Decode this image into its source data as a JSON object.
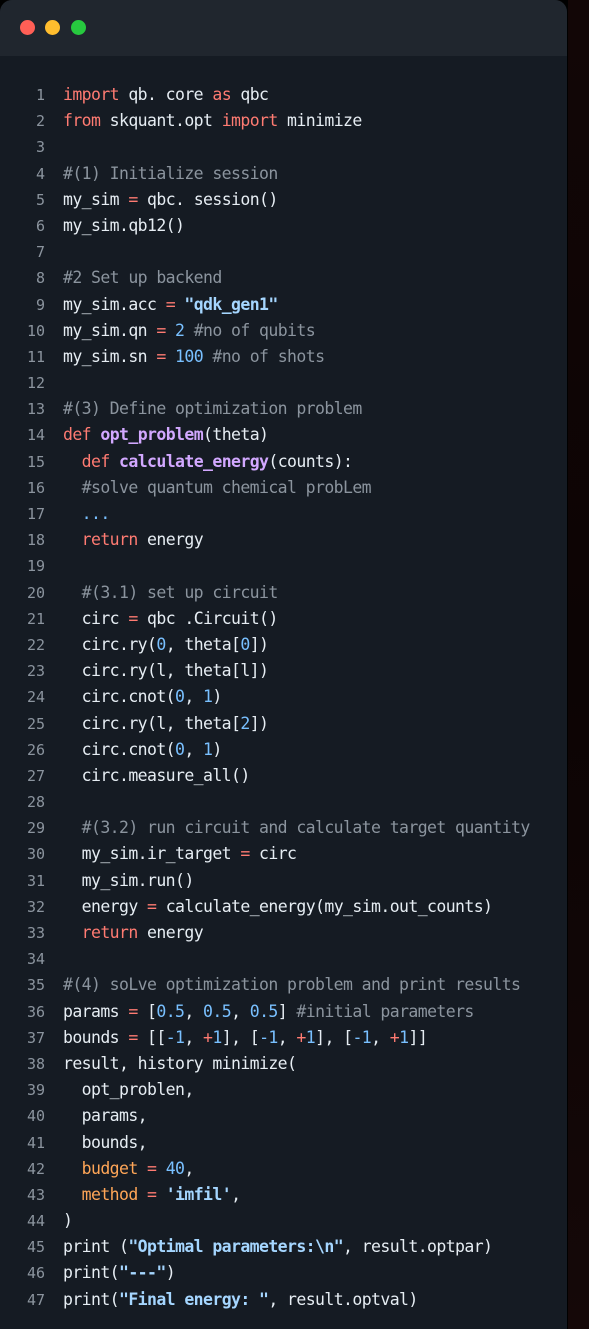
{
  "window": {
    "controls": [
      "close",
      "minimize",
      "maximize"
    ],
    "colors": {
      "background": "#151b23",
      "titlebar": "#20262e",
      "close": "#ff5f56",
      "minimize": "#ffbd2e",
      "maximize": "#27c93f"
    }
  },
  "syntax_colors": {
    "keyword": "#ff7b72",
    "function": "#d2a8ff",
    "string": "#a5d6ff",
    "number": "#79c0ff",
    "comment": "#8b949e",
    "plain": "#e6edf3",
    "argument": "#ffa657"
  },
  "lines": [
    {
      "n": "1",
      "tokens": [
        [
          "kw",
          "import"
        ],
        [
          "pl",
          " qb. core "
        ],
        [
          "kw",
          "as"
        ],
        [
          "pl",
          " qbc"
        ]
      ]
    },
    {
      "n": "2",
      "tokens": [
        [
          "kw",
          "from"
        ],
        [
          "pl",
          " skquant.opt "
        ],
        [
          "kw",
          "import"
        ],
        [
          "pl",
          " minimize"
        ]
      ]
    },
    {
      "n": "3",
      "tokens": []
    },
    {
      "n": "4",
      "tokens": [
        [
          "cm",
          "#(1) Initialize session"
        ]
      ]
    },
    {
      "n": "5",
      "tokens": [
        [
          "pl",
          "my_sim "
        ],
        [
          "op",
          "="
        ],
        [
          "pl",
          " qbc. session()"
        ]
      ]
    },
    {
      "n": "6",
      "tokens": [
        [
          "pl",
          "my_sim.qb12()"
        ]
      ]
    },
    {
      "n": "7",
      "tokens": []
    },
    {
      "n": "8",
      "tokens": [
        [
          "cm",
          "#2 Set up backend"
        ]
      ]
    },
    {
      "n": "9",
      "tokens": [
        [
          "pl",
          "my_sim.acc "
        ],
        [
          "op",
          "="
        ],
        [
          "pl",
          " "
        ],
        [
          "str",
          "\"qdk_gen1\""
        ]
      ]
    },
    {
      "n": "10",
      "tokens": [
        [
          "pl",
          "my_sim.qn "
        ],
        [
          "op",
          "="
        ],
        [
          "pl",
          " "
        ],
        [
          "num",
          "2"
        ],
        [
          "pl",
          " "
        ],
        [
          "cm",
          "#no of qubits"
        ]
      ]
    },
    {
      "n": "11",
      "tokens": [
        [
          "pl",
          "my_sim.sn "
        ],
        [
          "op",
          "="
        ],
        [
          "pl",
          " "
        ],
        [
          "num",
          "100"
        ],
        [
          "pl",
          " "
        ],
        [
          "cm",
          "#no of shots"
        ]
      ]
    },
    {
      "n": "12",
      "tokens": []
    },
    {
      "n": "13",
      "tokens": [
        [
          "cm",
          "#(3) Define optimization problem"
        ]
      ]
    },
    {
      "n": "14",
      "tokens": [
        [
          "kw",
          "def"
        ],
        [
          "pl",
          " "
        ],
        [
          "fn",
          "opt_problem"
        ],
        [
          "pl",
          "(theta)"
        ]
      ]
    },
    {
      "n": "15",
      "tokens": [
        [
          "pl",
          "  "
        ],
        [
          "kw",
          "def"
        ],
        [
          "pl",
          " "
        ],
        [
          "fn",
          "calculate_energy"
        ],
        [
          "pl",
          "(counts):"
        ]
      ]
    },
    {
      "n": "16",
      "tokens": [
        [
          "pl",
          "  "
        ],
        [
          "cm",
          "#solve quantum chemical probLem"
        ]
      ]
    },
    {
      "n": "17",
      "tokens": [
        [
          "pl",
          "  "
        ],
        [
          "num",
          "..."
        ]
      ]
    },
    {
      "n": "18",
      "tokens": [
        [
          "pl",
          "  "
        ],
        [
          "kw",
          "return"
        ],
        [
          "pl",
          " energy"
        ]
      ]
    },
    {
      "n": "19",
      "tokens": []
    },
    {
      "n": "20",
      "tokens": [
        [
          "pl",
          "  "
        ],
        [
          "cm",
          "#(3.1) set up circuit"
        ]
      ]
    },
    {
      "n": "21",
      "tokens": [
        [
          "pl",
          "  circ "
        ],
        [
          "op",
          "="
        ],
        [
          "pl",
          " qbc .Circuit()"
        ]
      ]
    },
    {
      "n": "22",
      "tokens": [
        [
          "pl",
          "  circ.ry("
        ],
        [
          "num",
          "0"
        ],
        [
          "pl",
          ", theta["
        ],
        [
          "num",
          "0"
        ],
        [
          "pl",
          "])"
        ]
      ]
    },
    {
      "n": "23",
      "tokens": [
        [
          "pl",
          "  circ.ry(l, theta[l])"
        ]
      ]
    },
    {
      "n": "24",
      "tokens": [
        [
          "pl",
          "  circ.cnot("
        ],
        [
          "num",
          "0"
        ],
        [
          "pl",
          ", "
        ],
        [
          "num",
          "1"
        ],
        [
          "pl",
          ")"
        ]
      ]
    },
    {
      "n": "25",
      "tokens": [
        [
          "pl",
          "  circ.ry(l, theta["
        ],
        [
          "num",
          "2"
        ],
        [
          "pl",
          "])"
        ]
      ]
    },
    {
      "n": "26",
      "tokens": [
        [
          "pl",
          "  circ.cnot("
        ],
        [
          "num",
          "0"
        ],
        [
          "pl",
          ", "
        ],
        [
          "num",
          "1"
        ],
        [
          "pl",
          ")"
        ]
      ]
    },
    {
      "n": "27",
      "tokens": [
        [
          "pl",
          "  circ.measure_all()"
        ]
      ]
    },
    {
      "n": "28",
      "tokens": []
    },
    {
      "n": "29",
      "tokens": [
        [
          "pl",
          "  "
        ],
        [
          "cm",
          "#(3.2) run circuit and calculate target quantity"
        ]
      ]
    },
    {
      "n": "30",
      "tokens": [
        [
          "pl",
          "  my_sim.ir_target "
        ],
        [
          "op",
          "="
        ],
        [
          "pl",
          " circ"
        ]
      ]
    },
    {
      "n": "31",
      "tokens": [
        [
          "pl",
          "  my_sim.run()"
        ]
      ]
    },
    {
      "n": "32",
      "tokens": [
        [
          "pl",
          "  energy "
        ],
        [
          "op",
          "="
        ],
        [
          "pl",
          " calculate_energy(my_sim.out_counts)"
        ]
      ]
    },
    {
      "n": "33",
      "tokens": [
        [
          "pl",
          "  "
        ],
        [
          "kw",
          "return"
        ],
        [
          "pl",
          " energy"
        ]
      ]
    },
    {
      "n": "34",
      "tokens": []
    },
    {
      "n": "35",
      "tokens": [
        [
          "cm",
          "#(4) soLve optimization problem and print results"
        ]
      ]
    },
    {
      "n": "36",
      "tokens": [
        [
          "pl",
          "params "
        ],
        [
          "op",
          "="
        ],
        [
          "pl",
          " ["
        ],
        [
          "num",
          "0.5"
        ],
        [
          "pl",
          ", "
        ],
        [
          "num",
          "0.5"
        ],
        [
          "pl",
          ", "
        ],
        [
          "num",
          "0.5"
        ],
        [
          "pl",
          "] "
        ],
        [
          "cm",
          "#initial parameters"
        ]
      ]
    },
    {
      "n": "37",
      "tokens": [
        [
          "pl",
          "bounds "
        ],
        [
          "op",
          "="
        ],
        [
          "pl",
          " [["
        ],
        [
          "num",
          "-1"
        ],
        [
          "pl",
          ", "
        ],
        [
          "op",
          "+"
        ],
        [
          "num",
          "1"
        ],
        [
          "pl",
          "], ["
        ],
        [
          "num",
          "-1"
        ],
        [
          "pl",
          ", "
        ],
        [
          "op",
          "+"
        ],
        [
          "num",
          "1"
        ],
        [
          "pl",
          "], ["
        ],
        [
          "num",
          "-1"
        ],
        [
          "pl",
          ", "
        ],
        [
          "op",
          "+"
        ],
        [
          "num",
          "1"
        ],
        [
          "pl",
          "]]"
        ]
      ]
    },
    {
      "n": "38",
      "tokens": [
        [
          "pl",
          "result, history minimize("
        ]
      ]
    },
    {
      "n": "39",
      "tokens": [
        [
          "pl",
          "  opt_problen,"
        ]
      ]
    },
    {
      "n": "40",
      "tokens": [
        [
          "pl",
          "  params,"
        ]
      ]
    },
    {
      "n": "41",
      "tokens": [
        [
          "pl",
          "  bounds,"
        ]
      ]
    },
    {
      "n": "42",
      "tokens": [
        [
          "pl",
          "  "
        ],
        [
          "var",
          "budget"
        ],
        [
          "pl",
          " "
        ],
        [
          "op",
          "="
        ],
        [
          "pl",
          " "
        ],
        [
          "num",
          "40"
        ],
        [
          "pl",
          ","
        ]
      ]
    },
    {
      "n": "43",
      "tokens": [
        [
          "pl",
          "  "
        ],
        [
          "var",
          "method"
        ],
        [
          "pl",
          " "
        ],
        [
          "op",
          "="
        ],
        [
          "pl",
          " "
        ],
        [
          "str",
          "'imfil'"
        ],
        [
          "pl",
          ","
        ]
      ]
    },
    {
      "n": "44",
      "tokens": [
        [
          "pl",
          ")"
        ]
      ]
    },
    {
      "n": "45",
      "tokens": [
        [
          "nb",
          "print"
        ],
        [
          "pl",
          " ("
        ],
        [
          "str",
          "\"Optimal parameters:\\n\""
        ],
        [
          "pl",
          ", result.optpar)"
        ]
      ]
    },
    {
      "n": "46",
      "tokens": [
        [
          "nb",
          "print"
        ],
        [
          "pl",
          "("
        ],
        [
          "str",
          "\"---\""
        ],
        [
          "pl",
          ")"
        ]
      ]
    },
    {
      "n": "47",
      "tokens": [
        [
          "nb",
          "print"
        ],
        [
          "pl",
          "("
        ],
        [
          "str",
          "\"Final energy: \""
        ],
        [
          "pl",
          ", result.optval)"
        ]
      ]
    }
  ]
}
